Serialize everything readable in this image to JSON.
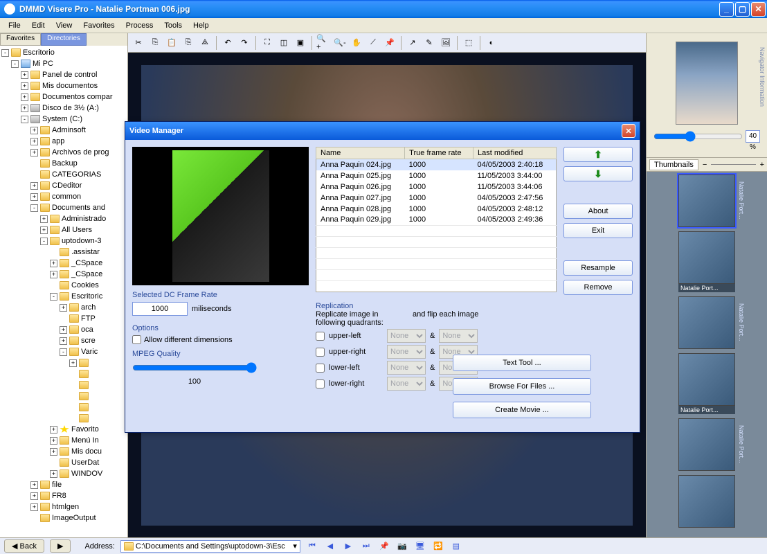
{
  "app": {
    "title": "DMMD Visere Pro - Natalie Portman 006.jpg"
  },
  "menubar": [
    "File",
    "Edit",
    "View",
    "Favorites",
    "Process",
    "Tools",
    "Help"
  ],
  "left_tabs": {
    "favorites": "Favorites",
    "directories": "Directories"
  },
  "tree": [
    {
      "indent": 0,
      "toggle": "-",
      "icon": "folder",
      "label": "Escritorio"
    },
    {
      "indent": 1,
      "toggle": "-",
      "icon": "pc",
      "label": "Mi PC"
    },
    {
      "indent": 2,
      "toggle": "+",
      "icon": "folder",
      "label": "Panel de control"
    },
    {
      "indent": 2,
      "toggle": "+",
      "icon": "folder",
      "label": "Mis documentos"
    },
    {
      "indent": 2,
      "toggle": "+",
      "icon": "folder",
      "label": "Documentos compar"
    },
    {
      "indent": 2,
      "toggle": "+",
      "icon": "drive",
      "label": "Disco de 3½ (A:)"
    },
    {
      "indent": 2,
      "toggle": "-",
      "icon": "drive",
      "label": "System (C:)"
    },
    {
      "indent": 3,
      "toggle": "+",
      "icon": "folder",
      "label": "Adminsoft"
    },
    {
      "indent": 3,
      "toggle": "+",
      "icon": "folder",
      "label": "app"
    },
    {
      "indent": 3,
      "toggle": "+",
      "icon": "folder",
      "label": "Archivos de prog"
    },
    {
      "indent": 3,
      "toggle": "",
      "icon": "folder",
      "label": "Backup"
    },
    {
      "indent": 3,
      "toggle": "",
      "icon": "folder",
      "label": "CATEGORIAS"
    },
    {
      "indent": 3,
      "toggle": "+",
      "icon": "folder",
      "label": "CDeditor"
    },
    {
      "indent": 3,
      "toggle": "+",
      "icon": "folder",
      "label": "common"
    },
    {
      "indent": 3,
      "toggle": "-",
      "icon": "folder",
      "label": "Documents and"
    },
    {
      "indent": 4,
      "toggle": "+",
      "icon": "folder",
      "label": "Administrado"
    },
    {
      "indent": 4,
      "toggle": "+",
      "icon": "folder",
      "label": "All Users"
    },
    {
      "indent": 4,
      "toggle": "-",
      "icon": "folder",
      "label": "uptodown-3"
    },
    {
      "indent": 5,
      "toggle": "",
      "icon": "folder",
      "label": ".assistar"
    },
    {
      "indent": 5,
      "toggle": "+",
      "icon": "folder",
      "label": "_CSpace"
    },
    {
      "indent": 5,
      "toggle": "+",
      "icon": "folder",
      "label": "_CSpace"
    },
    {
      "indent": 5,
      "toggle": "",
      "icon": "folder",
      "label": "Cookies"
    },
    {
      "indent": 5,
      "toggle": "-",
      "icon": "folder",
      "label": "Escritoric"
    },
    {
      "indent": 6,
      "toggle": "+",
      "icon": "folder",
      "label": "arch"
    },
    {
      "indent": 6,
      "toggle": "",
      "icon": "folder",
      "label": "FTP"
    },
    {
      "indent": 6,
      "toggle": "+",
      "icon": "folder",
      "label": "oca"
    },
    {
      "indent": 6,
      "toggle": "+",
      "icon": "folder",
      "label": "scre"
    },
    {
      "indent": 6,
      "toggle": "-",
      "icon": "folder",
      "label": "Varic"
    },
    {
      "indent": 7,
      "toggle": "+",
      "icon": "folder",
      "label": ""
    },
    {
      "indent": 7,
      "toggle": "",
      "icon": "folder",
      "label": ""
    },
    {
      "indent": 7,
      "toggle": "",
      "icon": "folder",
      "label": ""
    },
    {
      "indent": 7,
      "toggle": "",
      "icon": "folder",
      "label": ""
    },
    {
      "indent": 7,
      "toggle": "",
      "icon": "folder",
      "label": ""
    },
    {
      "indent": 7,
      "toggle": "",
      "icon": "folder",
      "label": ""
    },
    {
      "indent": 5,
      "toggle": "+",
      "icon": "star",
      "label": "Favorito"
    },
    {
      "indent": 5,
      "toggle": "+",
      "icon": "folder",
      "label": "Menú In"
    },
    {
      "indent": 5,
      "toggle": "+",
      "icon": "folder",
      "label": "Mis docu"
    },
    {
      "indent": 5,
      "toggle": "",
      "icon": "folder",
      "label": "UserDat"
    },
    {
      "indent": 5,
      "toggle": "+",
      "icon": "folder",
      "label": "WINDOV"
    },
    {
      "indent": 3,
      "toggle": "+",
      "icon": "folder",
      "label": "file"
    },
    {
      "indent": 3,
      "toggle": "+",
      "icon": "folder",
      "label": "FR8"
    },
    {
      "indent": 3,
      "toggle": "+",
      "icon": "folder",
      "label": "htmlgen"
    },
    {
      "indent": 3,
      "toggle": "",
      "icon": "folder",
      "label": "ImageOutput"
    }
  ],
  "navigator": {
    "label": "Navigator Information",
    "zoom": "40 %"
  },
  "thumbnails": {
    "tab": "Thumbnails",
    "items": [
      {
        "label": "",
        "side": "Natalie Port..."
      },
      {
        "label": "Natalie Port...",
        "side": ""
      },
      {
        "label": "",
        "side": "Natalie Port..."
      },
      {
        "label": "Natalie Port...",
        "side": ""
      },
      {
        "label": "",
        "side": "Natalie Port..."
      },
      {
        "label": "",
        "side": ""
      }
    ]
  },
  "bottom": {
    "back": "Back",
    "address_label": "Address:",
    "address": "C:\\Documents and Settings\\uptodown-3\\Esc"
  },
  "dialog": {
    "title": "Video Manager",
    "table": {
      "headers": [
        "Name",
        "True frame rate",
        "Last modified"
      ],
      "rows": [
        [
          "Anna Paquin 024.jpg",
          "1000",
          "04/05/2003 2:40:18"
        ],
        [
          "Anna Paquin 025.jpg",
          "1000",
          "11/05/2003 3:44:00"
        ],
        [
          "Anna Paquin 026.jpg",
          "1000",
          "11/05/2003 3:44:06"
        ],
        [
          "Anna Paquin 027.jpg",
          "1000",
          "04/05/2003 2:47:56"
        ],
        [
          "Anna Paquin 028.jpg",
          "1000",
          "04/05/2003 2:48:12"
        ],
        [
          "Anna Paquin 029.jpg",
          "1000",
          "04/05/2003 2:49:36"
        ]
      ]
    },
    "frame_rate": {
      "label": "Selected DC Frame Rate",
      "value": "1000",
      "unit": "miliseconds"
    },
    "options": {
      "label": "Options",
      "allow_dims": "Allow different dimensions"
    },
    "mpeg": {
      "label": "MPEG Quality",
      "value": "100"
    },
    "replication": {
      "label": "Replication",
      "hint1": "Replicate image in following quadrants:",
      "hint2": "and flip each image",
      "quads": [
        "upper-left",
        "upper-right",
        "lower-left",
        "lower-right"
      ],
      "none": "None",
      "amp": "&"
    },
    "buttons": {
      "up": "⬆",
      "down": "⬇",
      "about": "About",
      "exit": "Exit",
      "resample": "Resample",
      "remove": "Remove",
      "text_tool": "Text Tool ...",
      "browse": "Browse For Files ...",
      "create": "Create Movie ..."
    }
  }
}
